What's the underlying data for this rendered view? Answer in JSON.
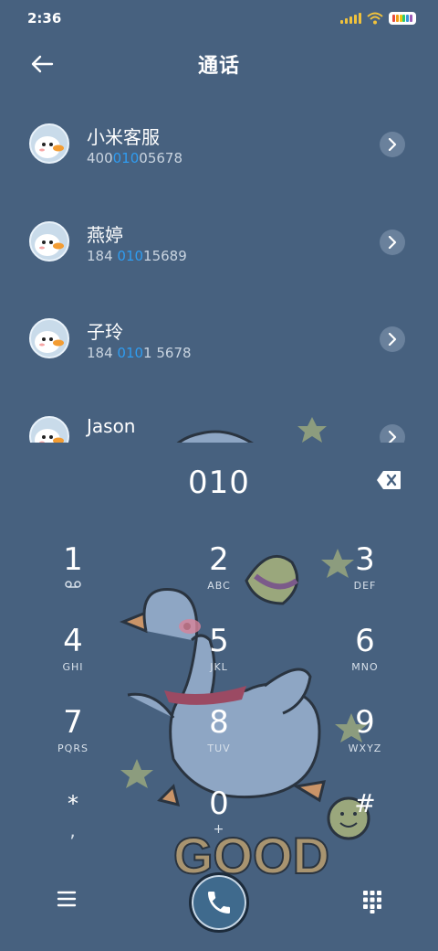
{
  "status": {
    "time": "2:36"
  },
  "header": {
    "title": "通话"
  },
  "contacts": [
    {
      "name": "小米客服",
      "num_pre": "400",
      "num_hl": "010",
      "num_post": "05678"
    },
    {
      "name": "燕婷",
      "num_pre": "184 ",
      "num_hl": "010",
      "num_post": "15689"
    },
    {
      "name": "子玲",
      "num_pre": "184 ",
      "num_hl": "010",
      "num_post": "1 5678"
    },
    {
      "name": "Jason",
      "num_pre": "",
      "num_hl": "",
      "num_post": ""
    }
  ],
  "dialer": {
    "entered": "010",
    "keys": [
      {
        "digit": "1",
        "sub": ""
      },
      {
        "digit": "2",
        "sub": "ABC"
      },
      {
        "digit": "3",
        "sub": "DEF"
      },
      {
        "digit": "4",
        "sub": "GHI"
      },
      {
        "digit": "5",
        "sub": "JKL"
      },
      {
        "digit": "6",
        "sub": "MNO"
      },
      {
        "digit": "7",
        "sub": "PQRS"
      },
      {
        "digit": "8",
        "sub": "TUV"
      },
      {
        "digit": "9",
        "sub": "WXYZ"
      },
      {
        "digit": "*",
        "sub": ","
      },
      {
        "digit": "0",
        "sub": "+"
      },
      {
        "digit": "#",
        "sub": ""
      }
    ]
  },
  "decor": {
    "sticker_text": "GOOD"
  },
  "colors": {
    "background": "#47617f",
    "highlight": "#2f9cf0"
  },
  "icons": [
    "back-arrow-icon",
    "chevron-right-icon",
    "backspace-icon",
    "voicemail-icon",
    "menu-icon",
    "phone-icon",
    "dialpad-icon"
  ]
}
